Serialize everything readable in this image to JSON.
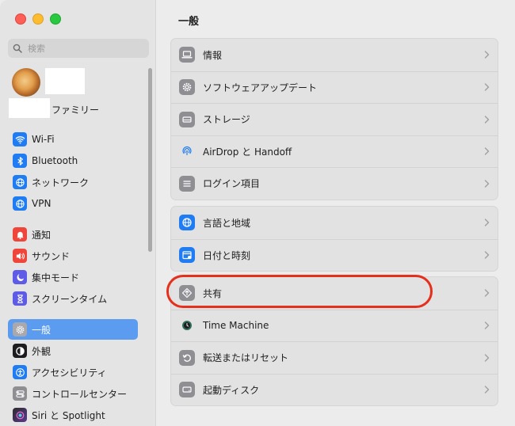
{
  "window": {
    "title": "一般"
  },
  "sidebar": {
    "search_placeholder": "検索",
    "family_label": "ファミリー",
    "items": [
      {
        "label": "Wi-Fi",
        "icon": "wifi-icon",
        "color": "#1f7cf3"
      },
      {
        "label": "Bluetooth",
        "icon": "bluetooth-icon",
        "color": "#1f7cf3"
      },
      {
        "label": "ネットワーク",
        "icon": "globe-icon",
        "color": "#1f7cf3"
      },
      {
        "label": "VPN",
        "icon": "globe-icon",
        "color": "#1f7cf3"
      },
      {
        "label": "通知",
        "icon": "bell-icon",
        "color": "#f0453a"
      },
      {
        "label": "サウンド",
        "icon": "speaker-icon",
        "color": "#f0453a"
      },
      {
        "label": "集中モード",
        "icon": "moon-icon",
        "color": "#5e5ce6"
      },
      {
        "label": "スクリーンタイム",
        "icon": "hourglass-icon",
        "color": "#5e5ce6"
      },
      {
        "label": "一般",
        "icon": "gear-icon",
        "color": "#8e8e93",
        "selected": true
      },
      {
        "label": "外観",
        "icon": "appearance-icon",
        "color": "#1d1d1f"
      },
      {
        "label": "アクセシビリティ",
        "icon": "accessibility-icon",
        "color": "#1f7cf3"
      },
      {
        "label": "コントロールセンター",
        "icon": "control-center-icon",
        "color": "#8e8e93"
      },
      {
        "label": "Siri と Spotlight",
        "icon": "siri-icon",
        "color": "#2b2b2b"
      }
    ]
  },
  "main": {
    "groups": [
      {
        "rows": [
          {
            "label": "情報",
            "icon": "laptop-icon"
          },
          {
            "label": "ソフトウェアアップデート",
            "icon": "gear-badge-icon"
          },
          {
            "label": "ストレージ",
            "icon": "drive-icon"
          },
          {
            "label": "AirDrop と Handoff",
            "icon": "airdrop-icon"
          },
          {
            "label": "ログイン項目",
            "icon": "list-icon"
          }
        ]
      },
      {
        "rows": [
          {
            "label": "言語と地域",
            "icon": "globe-icon"
          },
          {
            "label": "日付と時刻",
            "icon": "calendar-icon"
          }
        ]
      },
      {
        "rows": [
          {
            "label": "共有",
            "icon": "sharing-icon"
          },
          {
            "label": "Time Machine",
            "icon": "time-machine-icon"
          },
          {
            "label": "転送またはリセット",
            "icon": "reset-icon"
          },
          {
            "label": "起動ディスク",
            "icon": "disk-icon"
          }
        ]
      }
    ]
  },
  "colors": {
    "accent": "#5b9cf0",
    "highlight_ring": "#e5301d"
  }
}
